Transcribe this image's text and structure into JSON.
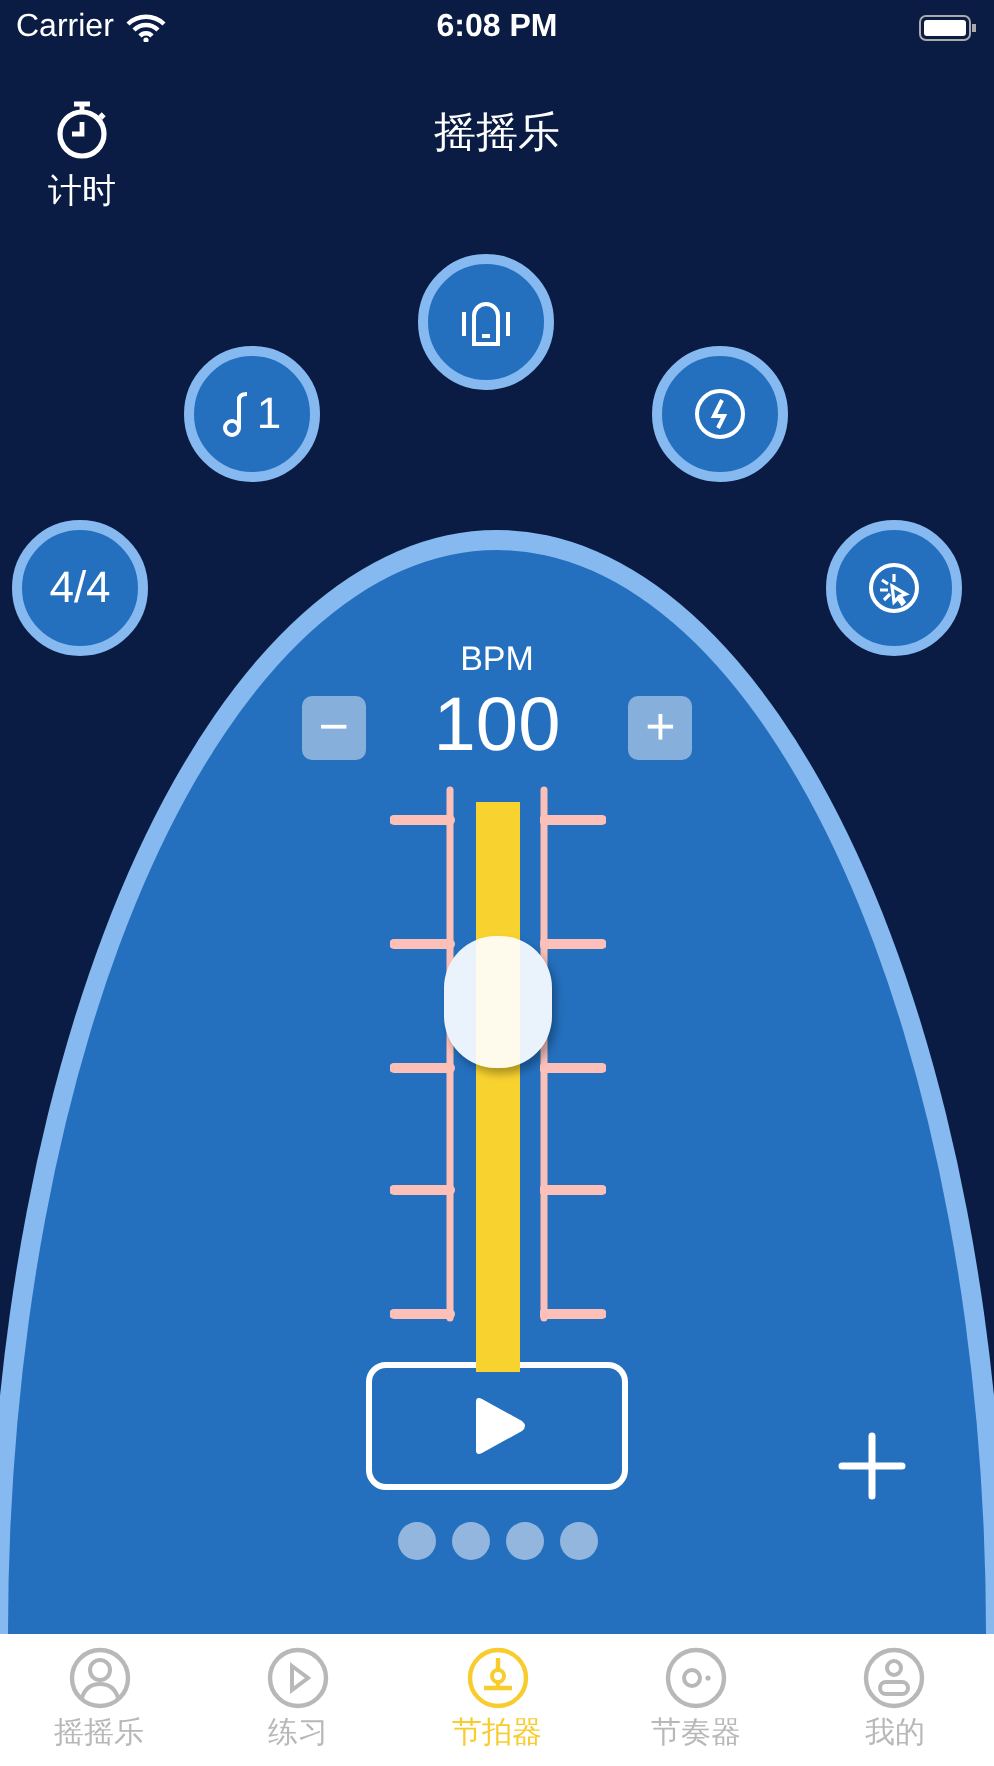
{
  "status_bar": {
    "carrier": "Carrier",
    "time": "6:08 PM"
  },
  "header": {
    "timer_label": "计时",
    "title": "摇摇乐"
  },
  "option_buttons": [
    {
      "kind": "text",
      "label": "4/4"
    },
    {
      "kind": "note",
      "label": "1"
    },
    {
      "kind": "bell"
    },
    {
      "kind": "bolt"
    },
    {
      "kind": "spark"
    }
  ],
  "tempo": {
    "unit": "BPM",
    "minus": "−",
    "value": "100",
    "plus": "+"
  },
  "slider": {
    "level": 0.65
  },
  "tabs": [
    {
      "label": "摇摇乐",
      "kind": "person",
      "selected": false
    },
    {
      "label": "练习",
      "kind": "play",
      "selected": false
    },
    {
      "label": "节拍器",
      "kind": "metronome",
      "selected": true
    },
    {
      "label": "节奏器",
      "kind": "disc",
      "selected": false
    },
    {
      "label": "我的",
      "kind": "profile",
      "selected": false
    }
  ]
}
